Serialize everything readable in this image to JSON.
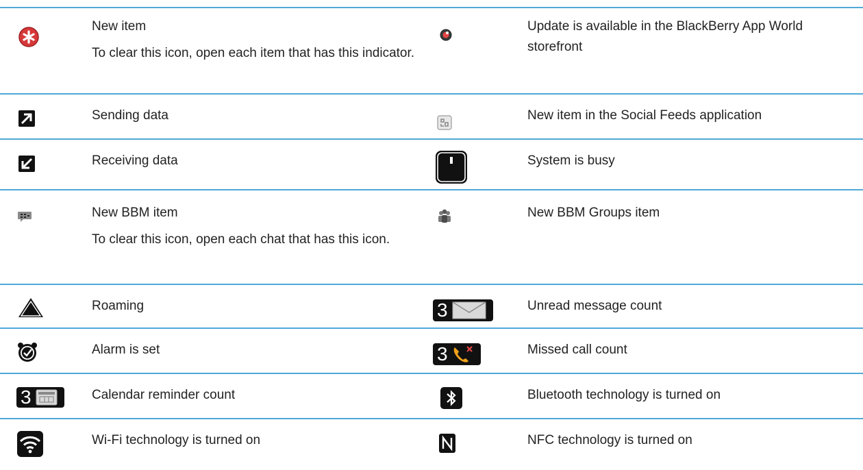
{
  "colors": {
    "separator": "#4ea9d6",
    "text": "#222222",
    "new_item_red": "#d7383a"
  },
  "rows": [
    {
      "left": {
        "icon": "new-item-star-icon",
        "title": "New item",
        "note": "To clear this icon, open each item that has this indicator."
      },
      "right": {
        "icon": "app-world-update-icon",
        "title": "Update is available in the BlackBerry App World storefront"
      }
    },
    {
      "left": {
        "icon": "sending-data-icon",
        "title": "Sending data"
      },
      "right": {
        "icon": "social-feeds-icon",
        "title": "New item in the Social Feeds application"
      }
    },
    {
      "left": {
        "icon": "receiving-data-icon",
        "title": "Receiving data"
      },
      "right": {
        "icon": "system-busy-icon",
        "title": "System is busy"
      }
    },
    {
      "left": {
        "icon": "bbm-item-icon",
        "title": "New BBM item",
        "note": "To clear this icon, open each chat that has this icon."
      },
      "right": {
        "icon": "bbm-groups-icon",
        "title": "New BBM Groups item"
      }
    },
    {
      "left": {
        "icon": "roaming-icon",
        "title": "Roaming"
      },
      "right": {
        "icon": "unread-message-icon",
        "title": "Unread message count",
        "badge": "3"
      }
    },
    {
      "left": {
        "icon": "alarm-icon",
        "title": "Alarm is set"
      },
      "right": {
        "icon": "missed-call-icon",
        "title": "Missed call count",
        "badge": "3"
      }
    },
    {
      "left": {
        "icon": "calendar-reminder-icon",
        "title": "Calendar reminder count",
        "badge": "3"
      },
      "right": {
        "icon": "bluetooth-icon",
        "title": "Bluetooth technology is turned on"
      }
    },
    {
      "left": {
        "icon": "wifi-icon",
        "title": "Wi-Fi technology is turned on"
      },
      "right": {
        "icon": "nfc-icon",
        "title": "NFC technology is turned on"
      }
    }
  ]
}
